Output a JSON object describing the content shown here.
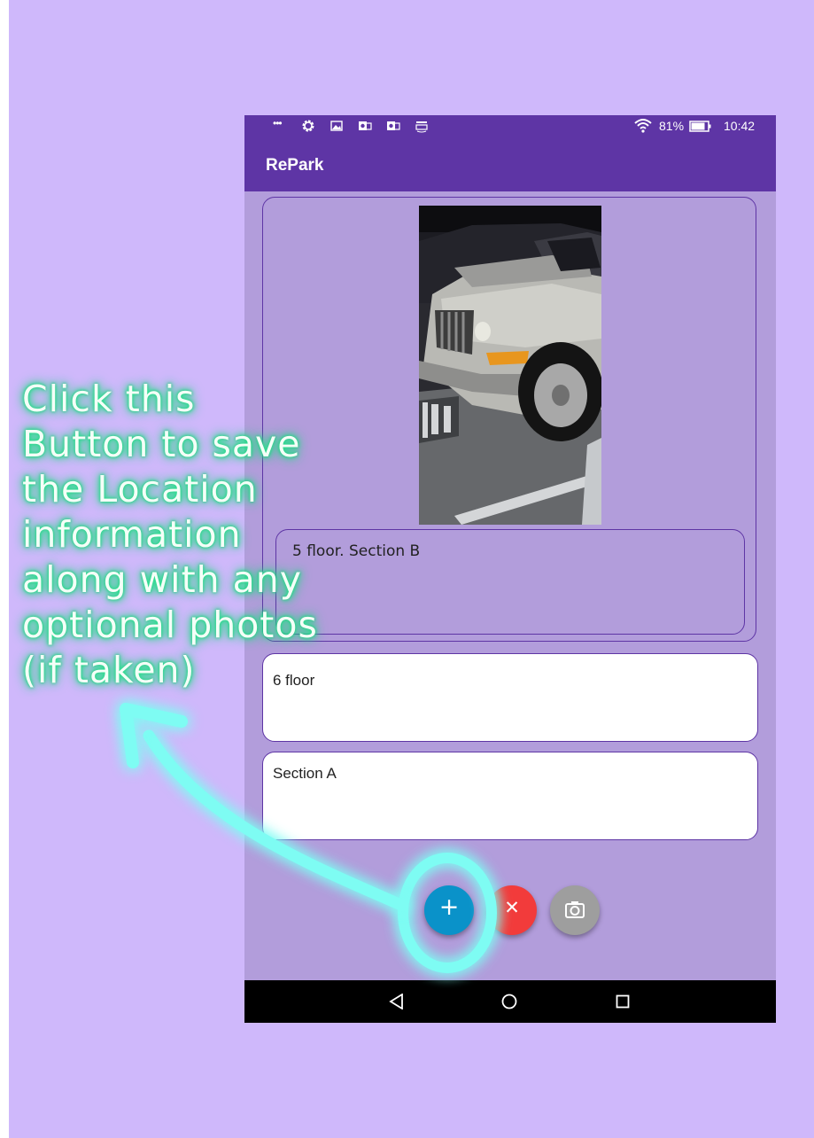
{
  "status_bar": {
    "overflow": "•••",
    "battery": "81%",
    "time": "10:42",
    "icons": [
      "overflow-dots-icon",
      "settings-icon",
      "gallery-icon",
      "outlook-icon",
      "outlook-icon",
      "amazon-icon",
      "wifi-icon",
      "battery-icon"
    ]
  },
  "app": {
    "title": "RePark"
  },
  "card": {
    "photo_alt": "parked car photo",
    "note": "5 floor. Section B"
  },
  "fields": {
    "floor_value": "6 floor",
    "section_value": "Section A"
  },
  "fabs": {
    "add_label": "+",
    "cancel_label": "✕",
    "add_color": "#0a92c9",
    "cancel_color": "#f23b3b",
    "camera_color": "#9e9e9e"
  },
  "annotation": {
    "lines": [
      "Click this",
      "Button to save",
      "the Location",
      "information",
      "along with any",
      "optional photos",
      "(if taken)"
    ],
    "glow_color": "#29e38f",
    "arrow_color": "#7efcf3"
  },
  "colors": {
    "background": "#cfb8fb",
    "app_bar": "#5e35a5",
    "screen": "#b29ddb"
  }
}
